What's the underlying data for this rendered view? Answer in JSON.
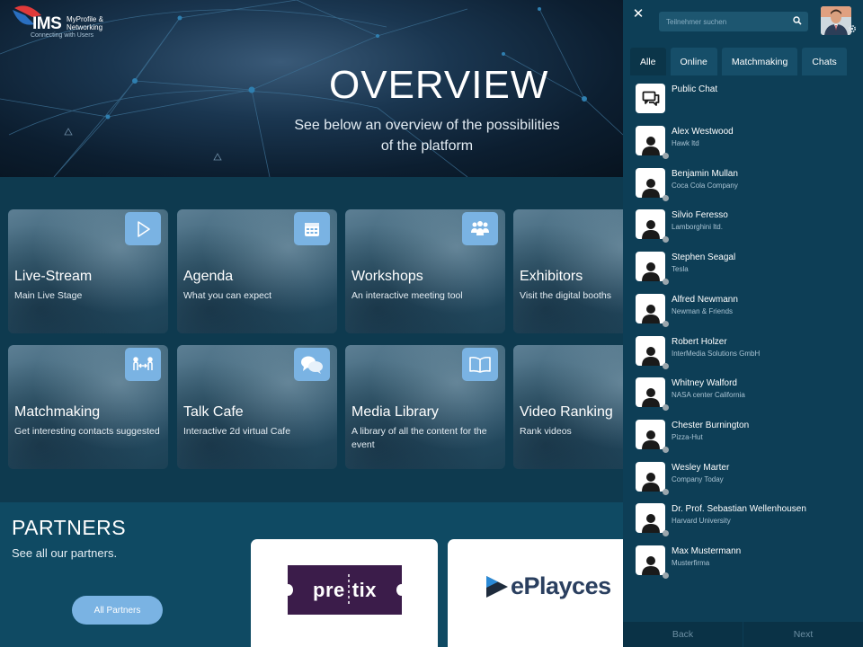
{
  "app": {
    "logo_text": "IMS",
    "logo_subtitle_1": "MyProfile &",
    "logo_subtitle_2": "Networking",
    "logo_tagline": "Connecting with Users"
  },
  "hero": {
    "title": "OVERVIEW",
    "subtitle": "See below an overview of the possibilities of the platform"
  },
  "tiles": [
    {
      "title": "Live-Stream",
      "subtitle": "Main Live Stage",
      "icon": "play-icon"
    },
    {
      "title": "Agenda",
      "subtitle": "What you can expect",
      "icon": "calendar-icon"
    },
    {
      "title": "Workshops",
      "subtitle": "An interactive meeting tool",
      "icon": "group-icon"
    },
    {
      "title": "Exhibitors",
      "subtitle": "Visit the digital booths",
      "icon": ""
    },
    {
      "title": "Matchmaking",
      "subtitle": "Get interesting contacts suggested",
      "icon": "matchmaking-icon"
    },
    {
      "title": "Talk Cafe",
      "subtitle": "Interactive 2d virtual Cafe",
      "icon": "chat-bubbles-icon"
    },
    {
      "title": "Media Library",
      "subtitle": "A library of all the content for the event",
      "icon": "book-icon"
    },
    {
      "title": "Video Ranking",
      "subtitle": "Rank videos",
      "icon": ""
    }
  ],
  "partners": {
    "title": "PARTNERS",
    "subtitle": "See all our partners.",
    "button_label": "All Partners",
    "logos": [
      {
        "name": "pretix",
        "text_left": "pre",
        "text_right": "tix"
      },
      {
        "name": "eplayces",
        "text": "ePlayces"
      }
    ]
  },
  "sidebar": {
    "search_placeholder": "Teilnehmer suchen",
    "tabs": [
      {
        "label": "Alle",
        "active": true
      },
      {
        "label": "Online",
        "active": false
      },
      {
        "label": "Matchmaking",
        "active": false
      },
      {
        "label": "Chats",
        "active": false
      }
    ],
    "public_chat": {
      "label": "Public Chat"
    },
    "participants": [
      {
        "name": "Alex Westwood",
        "company": "Hawk ltd"
      },
      {
        "name": "Benjamin Mullan",
        "company": "Coca Cola Company"
      },
      {
        "name": "Silvio Feresso",
        "company": "Lamborghini ltd."
      },
      {
        "name": "Stephen Seagal",
        "company": "Tesla"
      },
      {
        "name": "Alfred Newmann",
        "company": "Newman & Friends"
      },
      {
        "name": "Robert Holzer",
        "company": "InterMedia Solutions GmbH"
      },
      {
        "name": "Whitney Walford",
        "company": "NASA center California"
      },
      {
        "name": "Chester Burnington",
        "company": "Pizza-Hut"
      },
      {
        "name": "Wesley Marter",
        "company": "Company Today"
      },
      {
        "name": "Dr. Prof. Sebastian Wellenhousen",
        "company": "Harvard University"
      },
      {
        "name": "Max Mustermann",
        "company": "Musterfirma"
      }
    ],
    "footer": {
      "back_label": "Back",
      "next_label": "Next"
    }
  },
  "colors": {
    "accent": "#7ab3e3",
    "sidebar_bg": "#0d3e56",
    "partners_bg": "#0f4a63",
    "pretix_bg": "#3b1c4a"
  }
}
